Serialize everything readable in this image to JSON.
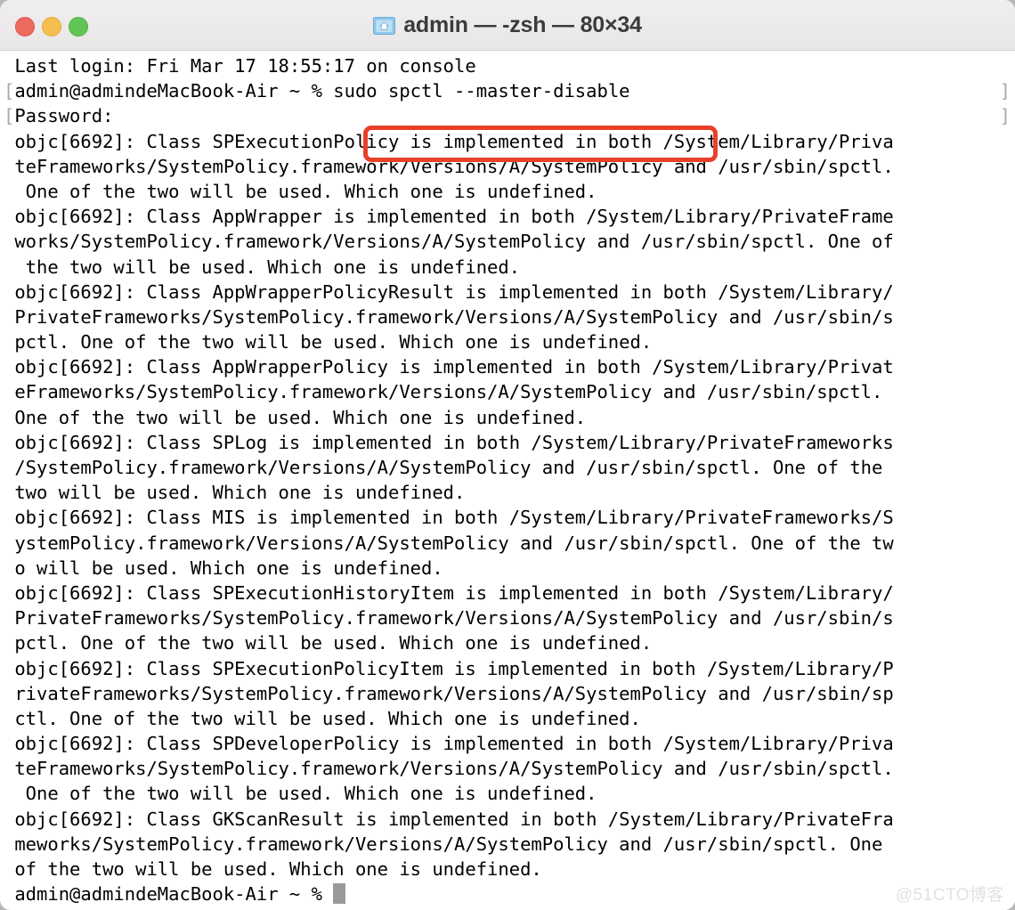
{
  "window": {
    "title": "admin — -zsh — 80×34",
    "icon": "home-folder-icon",
    "traffic_lights": {
      "close_color": "#ed6a5e",
      "minimize_color": "#f5bf4f",
      "maximize_color": "#61c555"
    }
  },
  "terminal": {
    "prompt": "admin@admindeMacBook-Air ~ %",
    "command": "sudo spctl --master-disable",
    "highlight_color": "#e8402a",
    "cursor": "block-cursor",
    "lines": [
      " Last login: Fri Mar 17 18:55:17 on console",
      "[admin@admindeMacBook-Air ~ % sudo spctl --master-disable",
      "[Password:",
      " objc[6692]: Class SPExecutionPolicy is implemented in both /System/Library/Priva",
      " teFrameworks/SystemPolicy.framework/Versions/A/SystemPolicy and /usr/sbin/spctl.",
      "  One of the two will be used. Which one is undefined.",
      " objc[6692]: Class AppWrapper is implemented in both /System/Library/PrivateFrame",
      " works/SystemPolicy.framework/Versions/A/SystemPolicy and /usr/sbin/spctl. One of",
      "  the two will be used. Which one is undefined.",
      " objc[6692]: Class AppWrapperPolicyResult is implemented in both /System/Library/",
      " PrivateFrameworks/SystemPolicy.framework/Versions/A/SystemPolicy and /usr/sbin/s",
      " pctl. One of the two will be used. Which one is undefined.",
      " objc[6692]: Class AppWrapperPolicy is implemented in both /System/Library/Privat",
      " eFrameworks/SystemPolicy.framework/Versions/A/SystemPolicy and /usr/sbin/spctl.",
      " One of the two will be used. Which one is undefined.",
      " objc[6692]: Class SPLog is implemented in both /System/Library/PrivateFrameworks",
      " /SystemPolicy.framework/Versions/A/SystemPolicy and /usr/sbin/spctl. One of the",
      " two will be used. Which one is undefined.",
      " objc[6692]: Class MIS is implemented in both /System/Library/PrivateFrameworks/S",
      " ystemPolicy.framework/Versions/A/SystemPolicy and /usr/sbin/spctl. One of the tw",
      " o will be used. Which one is undefined.",
      " objc[6692]: Class SPExecutionHistoryItem is implemented in both /System/Library/",
      " PrivateFrameworks/SystemPolicy.framework/Versions/A/SystemPolicy and /usr/sbin/s",
      " pctl. One of the two will be used. Which one is undefined.",
      " objc[6692]: Class SPExecutionPolicyItem is implemented in both /System/Library/P",
      " rivateFrameworks/SystemPolicy.framework/Versions/A/SystemPolicy and /usr/sbin/sp",
      " ctl. One of the two will be used. Which one is undefined.",
      " objc[6692]: Class SPDeveloperPolicy is implemented in both /System/Library/Priva",
      " teFrameworks/SystemPolicy.framework/Versions/A/SystemPolicy and /usr/sbin/spctl.",
      "  One of the two will be used. Which one is undefined.",
      " objc[6692]: Class GKScanResult is implemented in both /System/Library/PrivateFra",
      " meworks/SystemPolicy.framework/Versions/A/SystemPolicy and /usr/sbin/spctl. One",
      " of the two will be used. Which one is undefined.",
      " admin@admindeMacBook-Air ~ % "
    ],
    "right_brackets": [
      "]",
      "]"
    ]
  },
  "watermark": {
    "text": "@51CTO博客"
  }
}
